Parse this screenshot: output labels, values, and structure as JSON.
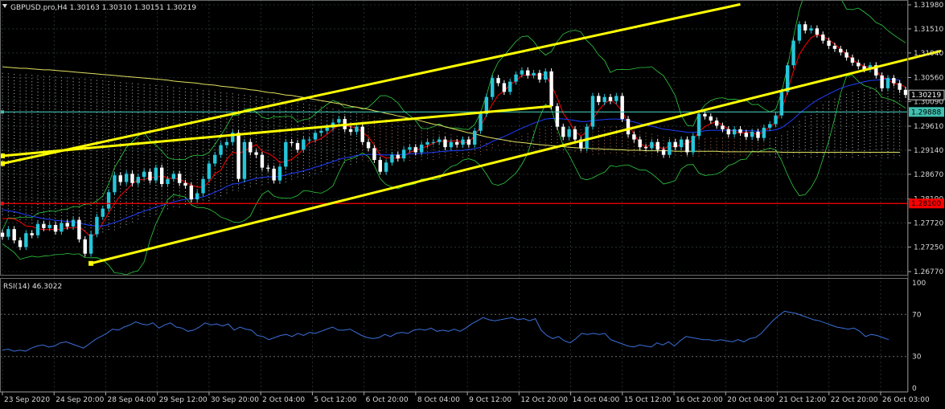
{
  "header": {
    "symbol_line": "GBPUSD.pro,H4  1.30163 1.30310 1.30151 1.30219",
    "rsi_label": "RSI(14) 46.3022"
  },
  "colors": {
    "background": "#000000",
    "bull_candle": "#26c6da",
    "bear_candle": "#ffffff",
    "trendline": "#ffff00",
    "support_line": "#ff0000",
    "current_line": "#40c0b0",
    "rsi_line": "#3a6fd8",
    "ma_fast": "#ff0000",
    "ma_mid": "#1f3fff",
    "bollinger": "#2ecc40",
    "long_ma": "#e0e060",
    "grid": "#3a4a4a"
  },
  "chart_data": [
    {
      "type": "candlestick",
      "title": "GBPUSD.pro,H4",
      "ohlc_current": {
        "open": 1.30163,
        "high": 1.3031,
        "low": 1.30151,
        "close": 1.30219
      },
      "y_ticks": [
        "1.31980",
        "1.31510",
        "1.31040",
        "1.30560",
        "1.30090",
        "1.29610",
        "1.29140",
        "1.28670",
        "1.28190",
        "1.27720",
        "1.27250",
        "1.26770"
      ],
      "ylim": [
        1.2677,
        1.3198
      ],
      "x_ticks": [
        "23 Sep 2020",
        "24 Sep 20:00",
        "28 Sep 04:00",
        "29 Sep 12:00",
        "30 Sep 20:00",
        "2 Oct 04:00",
        "5 Oct 12:00",
        "6 Oct 20:00",
        "8 Oct 04:00",
        "9 Oct 12:00",
        "12 Oct 20:00",
        "14 Oct 04:00",
        "15 Oct 12:00",
        "16 Oct 20:00",
        "20 Oct 04:00",
        "21 Oct 12:00",
        "22 Oct 20:00",
        "26 Oct 03:00"
      ],
      "price_labels": [
        {
          "value": 1.30219,
          "text": "1.30219"
        },
        {
          "value": 1.29888,
          "text": "1.29888"
        },
        {
          "value": 1.281,
          "text": "1.28100"
        }
      ],
      "horizontal_lines": [
        {
          "value": 1.29888,
          "role": "current-level"
        },
        {
          "value": 1.281,
          "role": "support"
        }
      ],
      "channel_lines": [
        {
          "from": [
            0,
            1.2888
          ],
          "to": [
            125,
            1.3199
          ]
        },
        {
          "from": [
            15,
            1.2693
          ],
          "to": [
            159,
            1.3108
          ]
        },
        {
          "from": [
            0,
            1.2903
          ],
          "to": [
            93,
            1.3
          ]
        }
      ],
      "candles_close": [
        1.2745,
        1.276,
        1.2738,
        1.2725,
        1.2752,
        1.2748,
        1.277,
        1.2762,
        1.2768,
        1.2755,
        1.2772,
        1.2765,
        1.2778,
        1.274,
        1.2712,
        1.275,
        1.2784,
        1.28,
        1.2832,
        1.2865,
        1.2852,
        1.2868,
        1.285,
        1.2862,
        1.2872,
        1.2855,
        1.288,
        1.2848,
        1.2858,
        1.2868,
        1.285,
        1.2845,
        1.2818,
        1.283,
        1.2858,
        1.2888,
        1.2905,
        1.2924,
        1.293,
        1.2948,
        1.2858,
        1.293,
        1.291,
        1.2905,
        1.288,
        1.2878,
        1.2855,
        1.2882,
        1.293,
        1.2928,
        1.2915,
        1.2935,
        1.2935,
        1.2948,
        1.2952,
        1.2958,
        1.2968,
        1.2975,
        1.2955,
        1.295,
        1.296,
        1.293,
        1.2918,
        1.2895,
        1.2872,
        1.289,
        1.2905,
        1.2898,
        1.2915,
        1.292,
        1.291,
        1.2925,
        1.293,
        1.293,
        1.2935,
        1.292,
        1.293,
        1.2925,
        1.2935,
        1.2925,
        1.2952,
        1.2985,
        1.3018,
        1.3055,
        1.3045,
        1.3028,
        1.3048,
        1.3062,
        1.307,
        1.306,
        1.3065,
        1.3052,
        1.3068,
        1.3,
        1.296,
        1.294,
        1.2955,
        1.2935,
        1.2918,
        1.296,
        1.302,
        1.3008,
        1.3018,
        1.301,
        1.302,
        1.2975,
        1.2945,
        1.2935,
        1.292,
        1.2918,
        1.293,
        1.2915,
        1.2905,
        1.293,
        1.292,
        1.2935,
        1.291,
        1.2942,
        1.2985,
        1.298,
        1.2972,
        1.2962,
        1.2955,
        1.2945,
        1.2955,
        1.2948,
        1.294,
        1.295,
        1.2938,
        1.2958,
        1.2965,
        1.2982,
        1.3028,
        1.308,
        1.3128,
        1.316,
        1.3148,
        1.3152,
        1.314,
        1.3128,
        1.3118,
        1.3112,
        1.3105,
        1.3095,
        1.3085,
        1.3078,
        1.3072,
        1.308,
        1.306,
        1.3035,
        1.3055,
        1.3045,
        1.3032,
        1.3022
      ],
      "series": [
        {
          "name": "ma_fast",
          "values": [
            1.278,
            1.2781,
            1.278,
            1.2774,
            1.2766,
            1.2765,
            1.2761,
            1.2759,
            1.2759,
            1.276,
            1.2759,
            1.2763,
            1.2762,
            1.2765,
            1.2755,
            1.2745,
            1.2752,
            1.2772,
            1.2792,
            1.281,
            1.2826,
            1.2836,
            1.2848,
            1.2857,
            1.2856,
            1.2862,
            1.286,
            1.2865,
            1.2859,
            1.2859,
            1.2858,
            1.2851,
            1.2846,
            1.2842,
            1.2842,
            1.2852,
            1.2868,
            1.2875,
            1.2896,
            1.291,
            1.2908,
            1.2912,
            1.2919,
            1.2925,
            1.2912,
            1.2908,
            1.2901,
            1.289,
            1.2892,
            1.2896,
            1.2905,
            1.2917,
            1.2929,
            1.2932,
            1.2937,
            1.2945,
            1.2955,
            1.2963,
            1.2962,
            1.296,
            1.2958,
            1.2949,
            1.294,
            1.2924,
            1.2904,
            1.2899,
            1.2899,
            1.2898,
            1.2902,
            1.291,
            1.2914,
            1.2918,
            1.2922,
            1.2928,
            1.2932,
            1.2931,
            1.2932,
            1.2933,
            1.2928,
            1.293,
            1.2942,
            1.296,
            1.2983,
            1.3004,
            1.3022,
            1.303,
            1.3042,
            1.3049,
            1.306,
            1.3061,
            1.3061,
            1.3061,
            1.3062,
            1.3041,
            1.3016,
            1.2986,
            1.297,
            1.2951,
            1.2942,
            1.295,
            1.2974,
            1.2992,
            1.3005,
            1.3013,
            1.3004,
            1.299,
            1.2966,
            1.2945,
            1.2928,
            1.292,
            1.2926,
            1.2922,
            1.2916,
            1.2923,
            1.292,
            1.2926,
            1.2927,
            1.2934,
            1.295,
            1.296,
            1.2966,
            1.297,
            1.2963,
            1.2955,
            1.295,
            1.2947,
            1.2949,
            1.2948,
            1.2944,
            1.2951,
            1.296,
            1.2968,
            1.2992,
            1.303,
            1.3068,
            1.3101,
            1.3119,
            1.3134,
            1.314,
            1.3136,
            1.313,
            1.3121,
            1.3111,
            1.3101,
            1.3091,
            1.3083,
            1.3078,
            1.3075,
            1.3069,
            1.3057,
            1.3052,
            1.3044,
            1.3043,
            1.3037
          ]
        },
        {
          "name": "ma_mid",
          "values": [
            1.2798,
            1.2796,
            1.2794,
            1.2791,
            1.2788,
            1.2785,
            1.2783,
            1.278,
            1.2779,
            1.2777,
            1.2776,
            1.2775,
            1.2774,
            1.2772,
            1.2769,
            1.2767,
            1.2766,
            1.2766,
            1.2769,
            1.2773,
            1.2777,
            1.2782,
            1.2786,
            1.2791,
            1.2795,
            1.2799,
            1.2803,
            1.2806,
            1.281,
            1.2813,
            1.2816,
            1.2818,
            1.2819,
            1.2821,
            1.2823,
            1.2827,
            1.2832,
            1.2837,
            1.2843,
            1.2848,
            1.2849,
            1.2853,
            1.2856,
            1.2859,
            1.2861,
            1.2862,
            1.2862,
            1.2863,
            1.2866,
            1.2869,
            1.2871,
            1.2874,
            1.2877,
            1.2881,
            1.2884,
            1.2888,
            1.2892,
            1.2896,
            1.2899,
            1.2901,
            1.2904,
            1.2905,
            1.2906,
            1.2906,
            1.2905,
            1.2905,
            1.2905,
            1.2905,
            1.2906,
            1.2907,
            1.2907,
            1.2908,
            1.2909,
            1.291,
            1.2911,
            1.2912,
            1.2913,
            1.2913,
            1.2914,
            1.2915,
            1.2917,
            1.292,
            1.2925,
            1.2931,
            1.2936,
            1.2941,
            1.2946,
            1.2952,
            1.2957,
            1.2962,
            1.2967,
            1.2971,
            1.2975,
            1.2976,
            1.2976,
            1.2975,
            1.2974,
            1.2972,
            1.297,
            1.297,
            1.2972,
            1.2973,
            1.2974,
            1.2975,
            1.2975,
            1.2974,
            1.2972,
            1.2969,
            1.2966,
            1.2963,
            1.2961,
            1.2958,
            1.2955,
            1.2954,
            1.2952,
            1.2951,
            1.2949,
            1.2949,
            1.295,
            1.2952,
            1.2953,
            1.2953,
            1.2953,
            1.2953,
            1.2953,
            1.2952,
            1.2952,
            1.2952,
            1.2951,
            1.2952,
            1.2952,
            1.2954,
            1.2958,
            1.2966,
            1.2975,
            1.2986,
            1.2995,
            1.3004,
            1.3012,
            1.3018,
            1.3024,
            1.303,
            1.3035,
            1.3039,
            1.3042,
            1.3045,
            1.3048,
            1.305,
            1.3051,
            1.3052,
            1.3053,
            1.3052,
            1.3051
          ]
        },
        {
          "name": "long_ma",
          "values": [
            1.3077,
            1.3076,
            1.3075,
            1.3074,
            1.3074,
            1.3073,
            1.3072,
            1.3071,
            1.3071,
            1.307,
            1.3069,
            1.3068,
            1.3067,
            1.3066,
            1.3065,
            1.3064,
            1.3063,
            1.3062,
            1.3061,
            1.306,
            1.3059,
            1.3058,
            1.3057,
            1.3056,
            1.3055,
            1.3054,
            1.3053,
            1.3052,
            1.3051,
            1.3049,
            1.3048,
            1.3047,
            1.3046,
            1.3045,
            1.3043,
            1.3042,
            1.3041,
            1.3039,
            1.3038,
            1.3037,
            1.3035,
            1.3034,
            1.3032,
            1.3031,
            1.3029,
            1.3027,
            1.3026,
            1.3024,
            1.3022,
            1.3021,
            1.3019,
            1.3017,
            1.3015,
            1.3013,
            1.3011,
            1.3009,
            1.3007,
            1.3005,
            1.3003,
            1.3,
            1.2998,
            1.2996,
            1.2994,
            1.2991,
            1.2989,
            1.2986,
            1.2984,
            1.2981,
            1.2979,
            1.2976,
            1.2974,
            1.2971,
            1.2968,
            1.2965,
            1.2963,
            1.296,
            1.2957,
            1.2954,
            1.2951,
            1.2948,
            1.2946,
            1.2943,
            1.294,
            1.2938,
            1.2936,
            1.2934,
            1.2932,
            1.293,
            1.2929,
            1.2928,
            1.2926,
            1.2925,
            1.2924,
            1.2923,
            1.2922,
            1.2921,
            1.292,
            1.2919,
            1.2918,
            1.2918,
            1.2917,
            1.2917,
            1.2916,
            1.2916,
            1.2915,
            1.2915,
            1.2914,
            1.2914,
            1.2914,
            1.2913,
            1.2913,
            1.2913,
            1.2913,
            1.2913,
            1.2912,
            1.2912,
            1.2912,
            1.2912,
            1.2912,
            1.2912,
            1.2912,
            1.2912,
            1.2911,
            1.2911,
            1.2911,
            1.2911,
            1.2911,
            1.2911,
            1.2911,
            1.2911,
            1.2911,
            1.2911,
            1.291,
            1.291,
            1.291,
            1.291,
            1.291,
            1.291,
            1.291,
            1.291,
            1.291,
            1.291,
            1.291,
            1.291,
            1.291,
            1.291,
            1.291,
            1.291,
            1.291,
            1.291,
            1.291,
            1.291,
            1.291
          ]
        }
      ]
    },
    {
      "type": "line",
      "title": "RSI(14) 46.3022",
      "ylim": [
        0,
        100
      ],
      "y_ticks": [
        "100",
        "70",
        "30",
        "0"
      ],
      "levels": [
        70,
        30
      ],
      "series": [
        {
          "name": "RSI(14)",
          "values": [
            36,
            37,
            35,
            36,
            35,
            38,
            40,
            41,
            39,
            40,
            43,
            44,
            42,
            40,
            38,
            42,
            46,
            49,
            52,
            56,
            55,
            58,
            60,
            63,
            61,
            60,
            62,
            57,
            60,
            62,
            58,
            57,
            54,
            55,
            58,
            62,
            60,
            61,
            59,
            61,
            55,
            58,
            56,
            55,
            50,
            49,
            46,
            48,
            50,
            51,
            49,
            52,
            50,
            53,
            52,
            54,
            56,
            58,
            55,
            55,
            56,
            53,
            50,
            48,
            47,
            48,
            51,
            49,
            52,
            53,
            52,
            55,
            56,
            55,
            57,
            54,
            55,
            54,
            56,
            54,
            57,
            61,
            64,
            67,
            65,
            64,
            65,
            66,
            67,
            65,
            66,
            64,
            66,
            55,
            50,
            47,
            49,
            45,
            43,
            47,
            52,
            51,
            52,
            51,
            52,
            46,
            44,
            42,
            40,
            39,
            41,
            40,
            39,
            43,
            41,
            44,
            40,
            45,
            49,
            48,
            47,
            46,
            46,
            45,
            46,
            45,
            44,
            46,
            44,
            47,
            48,
            52,
            58,
            64,
            69,
            73,
            72,
            71,
            69,
            67,
            65,
            64,
            62,
            60,
            58,
            57,
            56,
            57,
            54,
            49,
            51,
            50,
            48,
            46
          ]
        }
      ]
    }
  ]
}
